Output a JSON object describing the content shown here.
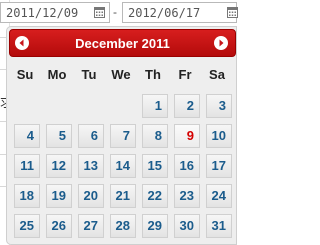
{
  "date_range": {
    "from_value": "2011/12/09",
    "separator": "-",
    "to_value": "2012/06/17"
  },
  "background": {
    "partial_glyph": "求"
  },
  "datepicker": {
    "month_title": "December 2011",
    "weekdays": [
      "Su",
      "Mo",
      "Tu",
      "We",
      "Th",
      "Fr",
      "Sa"
    ],
    "days": [
      "1",
      "2",
      "3",
      "4",
      "5",
      "6",
      "7",
      "8",
      "9",
      "10",
      "11",
      "12",
      "13",
      "14",
      "15",
      "16",
      "17",
      "18",
      "19",
      "20",
      "21",
      "22",
      "23",
      "24",
      "25",
      "26",
      "27",
      "28",
      "29",
      "30",
      "31"
    ],
    "first_weekday_index": 4,
    "highlighted_day": "9",
    "colors": {
      "header": "#c8141a",
      "day_text": "#1b5c8c",
      "highlighted_day_text": "#d40000"
    }
  }
}
